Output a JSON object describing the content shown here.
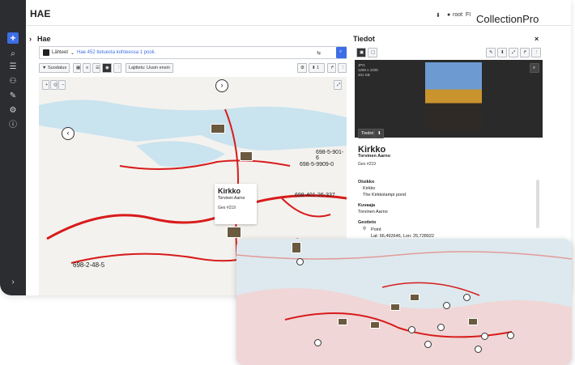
{
  "header": {
    "section": "HAE",
    "user": "root",
    "lang": "FI",
    "brand": "CollectionPro"
  },
  "search": {
    "title": "Hae",
    "sources_label": "Lähteet",
    "query": "Hae 452 tietuesta kohteessa 1 pooli.",
    "filter_label": "Suodatus",
    "sort_label": "Lajittelu: Uusin ensin",
    "count": "1"
  },
  "map": {
    "labels": [
      "698-5-901-6",
      "698-5-9909-0",
      "698-401-26-337",
      "698-2-48-5"
    ],
    "popup": {
      "title": "Kirkko",
      "subtitle": "Torvinen Aarno",
      "geo": "Geo #219"
    }
  },
  "details": {
    "title": "Tiedot",
    "image_meta": [
      "JPG",
      "1280 x 1025",
      "401 KB"
    ],
    "tab_label": "Tiedot",
    "record_title": "Kirkko",
    "record_subtitle": "Torvinen Aarno",
    "record_geo": "Geo #219",
    "fields": [
      {
        "label": "Otsikko",
        "values": [
          "Kirkko",
          "The Kirkkolampi pond"
        ]
      },
      {
        "label": "Kuvaaja",
        "values": [
          "Torvinen Aarno"
        ]
      },
      {
        "label": "Geotieto",
        "values": [
          "Point",
          "Lat: 66,492646, Lon: 25,728922"
        ]
      }
    ]
  },
  "colors": {
    "accent": "#3d6ee6",
    "sidebar": "#2b2d30",
    "route": "#d81b1b"
  }
}
